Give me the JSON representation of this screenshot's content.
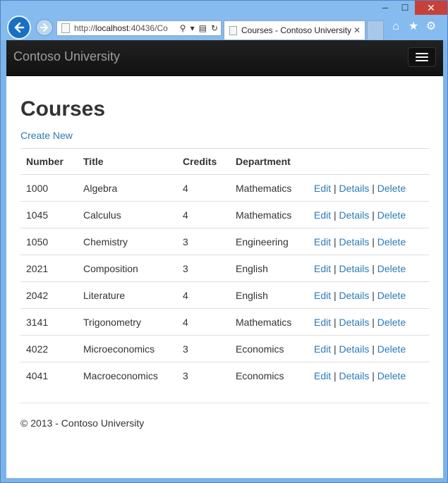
{
  "browser": {
    "url_prefix": "http://",
    "url_host": "localhost",
    "url_rest": ":40436/Co",
    "tab_title": "Courses - Contoso University",
    "window_controls": {
      "minimize": "─",
      "maximize": "☐",
      "close": "✕"
    }
  },
  "site": {
    "brand": "Contoso University",
    "page_title": "Courses",
    "create_link": "Create New",
    "columns": [
      "Number",
      "Title",
      "Credits",
      "Department"
    ],
    "rows": [
      {
        "number": "1000",
        "title": "Algebra",
        "credits": "4",
        "department": "Mathematics"
      },
      {
        "number": "1045",
        "title": "Calculus",
        "credits": "4",
        "department": "Mathematics"
      },
      {
        "number": "1050",
        "title": "Chemistry",
        "credits": "3",
        "department": "Engineering"
      },
      {
        "number": "2021",
        "title": "Composition",
        "credits": "3",
        "department": "English"
      },
      {
        "number": "2042",
        "title": "Literature",
        "credits": "4",
        "department": "English"
      },
      {
        "number": "3141",
        "title": "Trigonometry",
        "credits": "4",
        "department": "Mathematics"
      },
      {
        "number": "4022",
        "title": "Microeconomics",
        "credits": "3",
        "department": "Economics"
      },
      {
        "number": "4041",
        "title": "Macroeconomics",
        "credits": "3",
        "department": "Economics"
      }
    ],
    "actions": {
      "edit": "Edit",
      "details": "Details",
      "delete": "Delete",
      "separator": "|"
    },
    "footer": "© 2013 - Contoso University"
  },
  "colors": {
    "link": "#2a7ab5",
    "navbar": "#222222",
    "brand_text": "#9d9d9d",
    "frame": "#85bbee"
  }
}
